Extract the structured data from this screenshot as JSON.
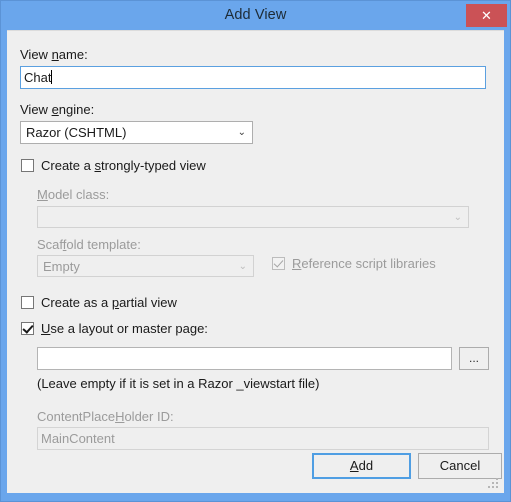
{
  "window": {
    "title": "Add View",
    "close_label": "✕",
    "frame_color": "#6aa6ec",
    "close_color": "#cb5256",
    "client_color": "#efefef"
  },
  "form": {
    "view_name": {
      "label_pre": "View ",
      "label_accel": "n",
      "label_post": "ame:",
      "value": "Chat",
      "focused": true
    },
    "view_engine": {
      "label_pre": "View ",
      "label_accel": "e",
      "label_post": "ngine:",
      "value": "Razor (CSHTML)",
      "chevron": "⌄"
    },
    "strongly_typed": {
      "label_pre": "Create a ",
      "label_accel": "s",
      "label_post": "trongly-typed view",
      "checked": false
    },
    "model_class": {
      "label_accel": "M",
      "label_post": "odel class:",
      "value": "",
      "chevron": "⌄",
      "enabled": false
    },
    "scaffold_template": {
      "label_pre": "Scaf",
      "label_accel": "f",
      "label_post": "old template:",
      "value": "Empty",
      "chevron": "⌄",
      "enabled": false
    },
    "reference_scripts": {
      "label_accel": "R",
      "label_post": "eference script libraries",
      "checked": true,
      "enabled": false
    },
    "partial_view": {
      "label_pre": "Create as a ",
      "label_accel": "p",
      "label_post": "artial view",
      "checked": false
    },
    "use_layout": {
      "label_accel": "U",
      "label_post": "se a layout or master page:",
      "checked": true
    },
    "layout_path": {
      "value": "",
      "browse_label": "..."
    },
    "layout_hint": "(Leave empty if it is set in a Razor _viewstart file)",
    "content_placeholder": {
      "label_pre": "ContentPlace",
      "label_accel": "H",
      "label_post": "older ID:",
      "value": "MainContent",
      "enabled": false
    }
  },
  "footer": {
    "add_label_accel": "A",
    "add_label_post": "dd",
    "cancel_label": "Cancel"
  }
}
